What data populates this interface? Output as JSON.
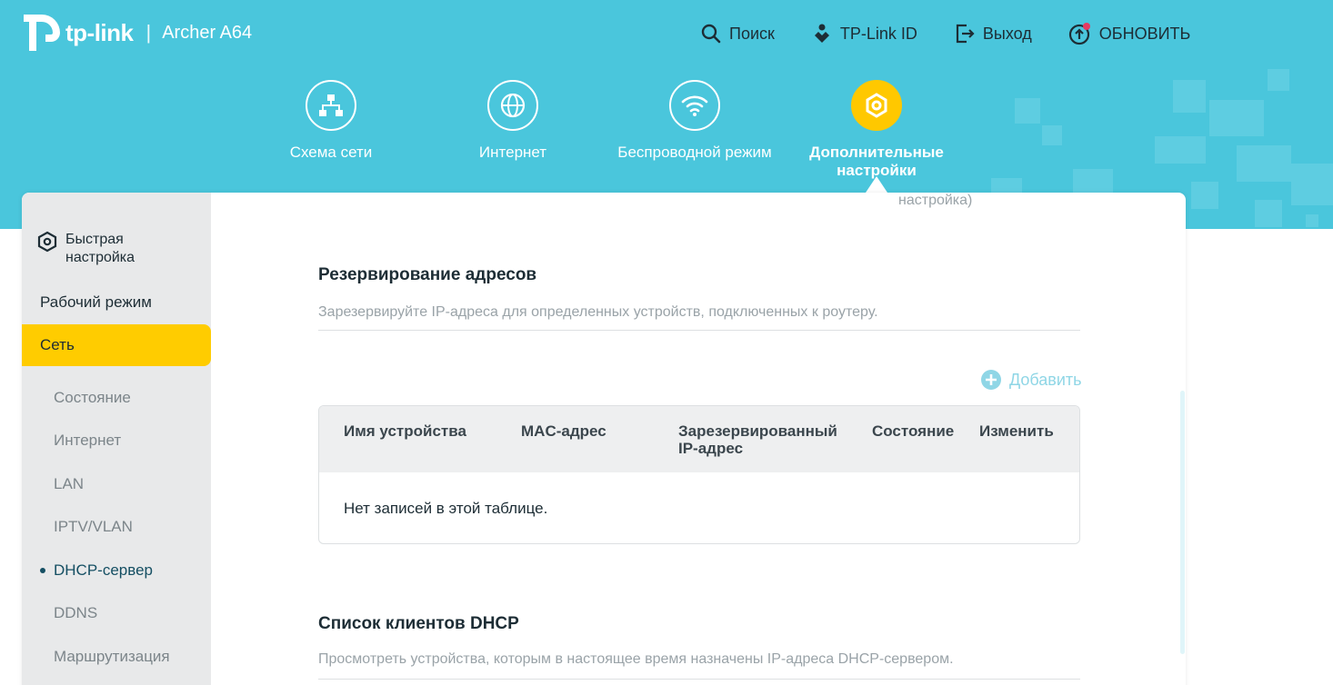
{
  "brand": {
    "logo_text": "tp-link",
    "separator": "|",
    "model": "Archer A64"
  },
  "topnav": [
    {
      "id": "search",
      "label": "Поиск",
      "icon": "search-icon"
    },
    {
      "id": "tplink-id",
      "label": "TP-Link ID",
      "icon": "user-diamond-icon"
    },
    {
      "id": "logout",
      "label": "Выход",
      "icon": "logout-icon"
    },
    {
      "id": "update",
      "label": "ОБНОВИТЬ",
      "icon": "update-icon"
    }
  ],
  "mainnav": [
    {
      "id": "network-map",
      "label": "Схема сети",
      "icon": "network-map-icon"
    },
    {
      "id": "internet",
      "label": "Интернет",
      "icon": "globe-icon"
    },
    {
      "id": "wireless",
      "label": "Беспроводной режим",
      "icon": "wifi-icon"
    },
    {
      "id": "advanced",
      "label": "Дополнительные настройки",
      "icon": "gear-icon",
      "active": true
    }
  ],
  "ghost_text": "настройка)",
  "sidebar": {
    "quick_setup": "Быстрая настройка",
    "operation_mode": "Рабочий режим",
    "network": "Сеть",
    "sub_items": [
      "Состояние",
      "Интернет",
      "LAN",
      "IPTV/VLAN",
      "DHCP-сервер",
      "DDNS",
      "Маршрутизация"
    ],
    "current_sub": "DHCP-сервер"
  },
  "reservation": {
    "title": "Резервирование адресов",
    "description": "Зарезервируйте IP-адреса для определенных устройств, подключенных к роутеру.",
    "add_label": "Добавить",
    "columns": [
      "Имя устройства",
      "MAC-адрес",
      "Зарезервированный IP-адрес",
      "Состояние",
      "Изменить"
    ],
    "empty_text": "Нет записей в этой таблице."
  },
  "dhcp_clients": {
    "title": "Список клиентов DHCP",
    "description": "Просмотреть устройства, которым в настоящее время назначены IP-адреса DHCP-сервером."
  },
  "colors": {
    "header": "#4ac6dc",
    "accent": "#ffcc00",
    "sidebar_bg": "#e8e9ea",
    "link": "#8fd6e6"
  }
}
